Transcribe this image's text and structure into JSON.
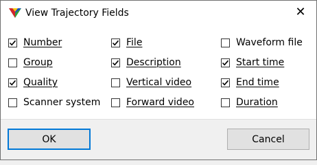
{
  "window": {
    "title": "View Trajectory Fields",
    "close_glyph": "✕",
    "icon": "app-triangle-icon"
  },
  "fields": [
    {
      "label": "Number",
      "checked": true
    },
    {
      "label": "Group",
      "checked": false
    },
    {
      "label": "Quality",
      "checked": true
    },
    {
      "label": "Scanner system",
      "checked": false
    },
    {
      "label": "File",
      "checked": true
    },
    {
      "label": "Description",
      "checked": true
    },
    {
      "label": "Vertical video",
      "checked": false
    },
    {
      "label": "Forward video",
      "checked": false
    },
    {
      "label": "Waveform file",
      "checked": false
    },
    {
      "label": "Start time",
      "checked": true
    },
    {
      "label": "End time",
      "checked": true
    },
    {
      "label": "Duration",
      "checked": false
    }
  ],
  "buttons": {
    "ok": "OK",
    "cancel": "Cancel"
  },
  "colors": {
    "accent": "#0078d7",
    "client_bg": "#ffffff",
    "footer_bg": "#f0f0f0"
  }
}
